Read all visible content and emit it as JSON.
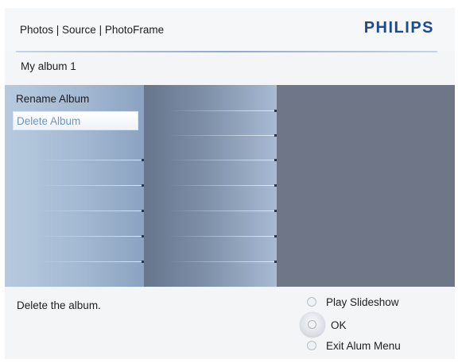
{
  "header": {
    "breadcrumb": "Photos | Source | PhotoFrame",
    "brand": "PHILIPS",
    "brand_color": "#1f4a92"
  },
  "album": {
    "title": "My album 1"
  },
  "menu": {
    "items": [
      {
        "label": "Rename Album",
        "selected": false
      },
      {
        "label": "Delete Album",
        "selected": true
      }
    ],
    "selected_color": "#6e95c6"
  },
  "footer": {
    "description": "Delete the album.",
    "controls": [
      {
        "label": "Play Slideshow",
        "icon": "circle-button-icon"
      },
      {
        "label": "OK",
        "icon": "ok-dial-icon"
      },
      {
        "label": "Exit Alum Menu",
        "icon": "circle-button-icon"
      }
    ]
  }
}
